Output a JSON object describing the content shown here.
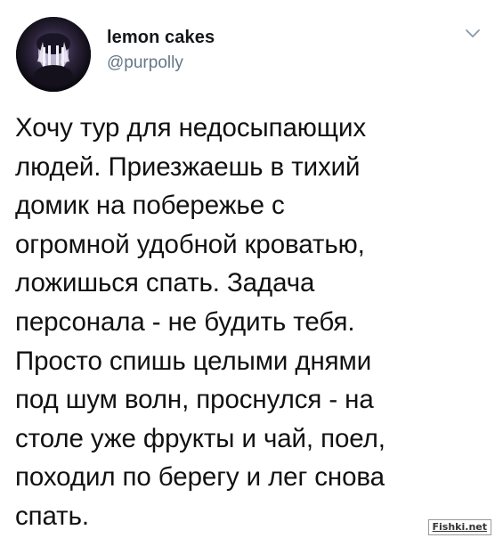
{
  "tweet": {
    "author": {
      "display_name": "lemon cakes",
      "handle": "@purpolly",
      "avatar_icon": "avatar-photo"
    },
    "caret_icon": "chevron-down-icon",
    "text_lines": [
      "Хочу тур для недосыпающих",
      "людей. Приезжаешь в тихий",
      "домик на побережье с",
      "огромной удобной кроватью,",
      "ложишься спать. Задача",
      "персонала - не будить тебя.",
      "Просто спишь целыми днями",
      "под шум волн, проснулся - на",
      "столе уже фрукты и чай, поел,",
      "походил по берегу и лег снова",
      "спать."
    ]
  },
  "watermark": {
    "text": "Fishki.net"
  },
  "colors": {
    "text": "#14171a",
    "secondary_text": "#657786",
    "background": "#ffffff"
  }
}
